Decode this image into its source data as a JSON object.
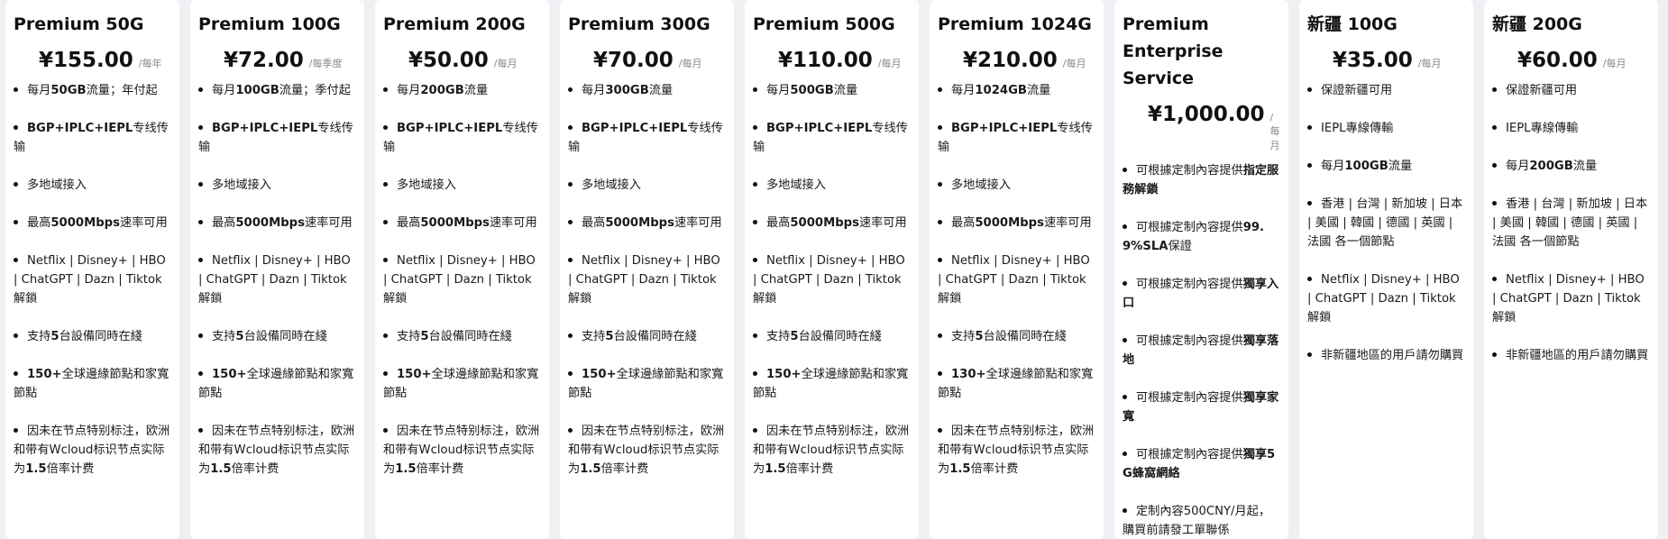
{
  "plans": [
    {
      "title": "Premium 50G",
      "price": "¥155.00",
      "period": "/每年",
      "features": [
        [
          {
            "t": "每月"
          },
          {
            "b": "50GB"
          },
          {
            "t": "流量；年付起"
          }
        ],
        [
          {
            "b": "BGP+IPLC+IEPL"
          },
          {
            "t": "专线传输"
          }
        ],
        [
          {
            "t": "多地域接入"
          }
        ],
        [
          {
            "t": "最高"
          },
          {
            "b": "5000Mbps"
          },
          {
            "t": "速率可用"
          }
        ],
        [
          {
            "t": "Netflix | Disney+ | HBO | ChatGPT | Dazn | Tiktok解鎖"
          }
        ],
        [
          {
            "t": "支持"
          },
          {
            "b": "5"
          },
          {
            "t": "台設備同時在綫"
          }
        ],
        [
          {
            "b": "150+"
          },
          {
            "t": "全球邊緣節點和家寬節點"
          }
        ],
        [
          {
            "t": "因未在节点特别标注，欧洲和带有Wcloud标识节点实际为"
          },
          {
            "b": "1.5"
          },
          {
            "t": "倍率计费"
          }
        ]
      ]
    },
    {
      "title": "Premium 100G",
      "price": "¥72.00",
      "period": "/每季度",
      "features": [
        [
          {
            "t": "每月"
          },
          {
            "b": "100GB"
          },
          {
            "t": "流量；季付起"
          }
        ],
        [
          {
            "b": "BGP+IPLC+IEPL"
          },
          {
            "t": "专线传输"
          }
        ],
        [
          {
            "t": "多地域接入"
          }
        ],
        [
          {
            "t": "最高"
          },
          {
            "b": "5000Mbps"
          },
          {
            "t": "速率可用"
          }
        ],
        [
          {
            "t": "Netflix | Disney+ | HBO | ChatGPT | Dazn | Tiktok解鎖"
          }
        ],
        [
          {
            "t": "支持"
          },
          {
            "b": "5"
          },
          {
            "t": "台設備同時在綫"
          }
        ],
        [
          {
            "b": "150+"
          },
          {
            "t": "全球邊緣節點和家寬節點"
          }
        ],
        [
          {
            "t": "因未在节点特别标注，欧洲和带有Wcloud标识节点实际为"
          },
          {
            "b": "1.5"
          },
          {
            "t": "倍率计费"
          }
        ]
      ]
    },
    {
      "title": "Premium 200G",
      "price": "¥50.00",
      "period": "/每月",
      "features": [
        [
          {
            "t": "每月"
          },
          {
            "b": "200GB"
          },
          {
            "t": "流量"
          }
        ],
        [
          {
            "b": "BGP+IPLC+IEPL"
          },
          {
            "t": "专线传输"
          }
        ],
        [
          {
            "t": "多地域接入"
          }
        ],
        [
          {
            "t": "最高"
          },
          {
            "b": "5000Mbps"
          },
          {
            "t": "速率可用"
          }
        ],
        [
          {
            "t": "Netflix | Disney+ | HBO | ChatGPT | Dazn | Tiktok解鎖"
          }
        ],
        [
          {
            "t": "支持"
          },
          {
            "b": "5"
          },
          {
            "t": "台設備同時在綫"
          }
        ],
        [
          {
            "b": "150+"
          },
          {
            "t": "全球邊緣節點和家寬節點"
          }
        ],
        [
          {
            "t": "因未在节点特别标注，欧洲和带有Wcloud标识节点实际为"
          },
          {
            "b": "1.5"
          },
          {
            "t": "倍率计费"
          }
        ]
      ]
    },
    {
      "title": "Premium 300G",
      "price": "¥70.00",
      "period": "/每月",
      "features": [
        [
          {
            "t": "每月"
          },
          {
            "b": "300GB"
          },
          {
            "t": "流量"
          }
        ],
        [
          {
            "b": "BGP+IPLC+IEPL"
          },
          {
            "t": "专线传输"
          }
        ],
        [
          {
            "t": "多地域接入"
          }
        ],
        [
          {
            "t": "最高"
          },
          {
            "b": "5000Mbps"
          },
          {
            "t": "速率可用"
          }
        ],
        [
          {
            "t": "Netflix | Disney+ | HBO | ChatGPT | Dazn | Tiktok解鎖"
          }
        ],
        [
          {
            "t": "支持"
          },
          {
            "b": "5"
          },
          {
            "t": "台設備同時在綫"
          }
        ],
        [
          {
            "b": "150+"
          },
          {
            "t": "全球邊緣節點和家寬節點"
          }
        ],
        [
          {
            "t": "因未在节点特别标注，欧洲和带有Wcloud标识节点实际为"
          },
          {
            "b": "1.5"
          },
          {
            "t": "倍率计费"
          }
        ]
      ]
    },
    {
      "title": "Premium 500G",
      "price": "¥110.00",
      "period": "/每月",
      "features": [
        [
          {
            "t": "每月"
          },
          {
            "b": "500GB"
          },
          {
            "t": "流量"
          }
        ],
        [
          {
            "b": "BGP+IPLC+IEPL"
          },
          {
            "t": "专线传输"
          }
        ],
        [
          {
            "t": "多地域接入"
          }
        ],
        [
          {
            "t": "最高"
          },
          {
            "b": "5000Mbps"
          },
          {
            "t": "速率可用"
          }
        ],
        [
          {
            "t": "Netflix | Disney+ | HBO | ChatGPT | Dazn | Tiktok解鎖"
          }
        ],
        [
          {
            "t": "支持"
          },
          {
            "b": "5"
          },
          {
            "t": "台設備同時在綫"
          }
        ],
        [
          {
            "b": "150+"
          },
          {
            "t": "全球邊緣節點和家寬節點"
          }
        ],
        [
          {
            "t": "因未在节点特别标注，欧洲和带有Wcloud标识节点实际为"
          },
          {
            "b": "1.5"
          },
          {
            "t": "倍率计费"
          }
        ]
      ]
    },
    {
      "title": "Premium 1024G",
      "price": "¥210.00",
      "period": "/每月",
      "features": [
        [
          {
            "t": "每月"
          },
          {
            "b": "1024GB"
          },
          {
            "t": "流量"
          }
        ],
        [
          {
            "b": "BGP+IPLC+IEPL"
          },
          {
            "t": "专线传输"
          }
        ],
        [
          {
            "t": "多地域接入"
          }
        ],
        [
          {
            "t": "最高"
          },
          {
            "b": "5000Mbps"
          },
          {
            "t": "速率可用"
          }
        ],
        [
          {
            "t": "Netflix | Disney+ | HBO | ChatGPT | Dazn | Tiktok解鎖"
          }
        ],
        [
          {
            "t": "支持"
          },
          {
            "b": "5"
          },
          {
            "t": "台設備同時在綫"
          }
        ],
        [
          {
            "b": "130+"
          },
          {
            "t": "全球邊緣節點和家寬節點"
          }
        ],
        [
          {
            "t": "因未在节点特别标注，欧洲和带有Wcloud标识节点实际为"
          },
          {
            "b": "1.5"
          },
          {
            "t": "倍率计费"
          }
        ]
      ]
    },
    {
      "title": "Premium Enterprise Service",
      "price": "¥1,000.00",
      "period": "/每月",
      "features": [
        [
          {
            "t": "可根據定制內容提供"
          },
          {
            "b": "指定服務解鎖"
          }
        ],
        [
          {
            "t": "可根據定制內容提供"
          },
          {
            "b": "99.9%SLA"
          },
          {
            "t": "保證"
          }
        ],
        [
          {
            "t": "可根據定制內容提供"
          },
          {
            "b": "獨享入口"
          }
        ],
        [
          {
            "t": "可根據定制內容提供"
          },
          {
            "b": "獨享落地"
          }
        ],
        [
          {
            "t": "可根據定制內容提供"
          },
          {
            "b": "獨享家寬"
          }
        ],
        [
          {
            "t": "可根據定制內容提供"
          },
          {
            "b": "獨享5G蜂窩網絡"
          }
        ],
        [
          {
            "t": "定制內容500CNY/月起，購買前請發工單聯係"
          }
        ]
      ]
    },
    {
      "title": "新疆 100G",
      "price": "¥35.00",
      "period": "/每月",
      "features": [
        [
          {
            "t": "保證新疆可用"
          }
        ],
        [
          {
            "t": "IEPL專線傳輸"
          }
        ],
        [
          {
            "t": "每月"
          },
          {
            "b": "100GB"
          },
          {
            "t": "流量"
          }
        ],
        [
          {
            "t": "香港 | 台灣 | 新加坡 | 日本 | 美國 | 韓國 | 德國 | 英國 | 法國 各一個節點"
          }
        ],
        [
          {
            "t": "Netflix | Disney+ | HBO | ChatGPT | Dazn | Tiktok解鎖"
          }
        ],
        [
          {
            "t": "非新疆地區的用戶請勿購買"
          }
        ]
      ]
    },
    {
      "title": "新疆 200G",
      "price": "¥60.00",
      "period": "/每月",
      "features": [
        [
          {
            "t": "保證新疆可用"
          }
        ],
        [
          {
            "t": "IEPL專線傳輸"
          }
        ],
        [
          {
            "t": "每月"
          },
          {
            "b": "200GB"
          },
          {
            "t": "流量"
          }
        ],
        [
          {
            "t": "香港 | 台灣 | 新加坡 | 日本 | 美國 | 韓國 | 德國 | 英國 | 法國 各一個節點"
          }
        ],
        [
          {
            "t": "Netflix | Disney+ | HBO | ChatGPT | Dazn | Tiktok解鎖"
          }
        ],
        [
          {
            "t": "非新疆地區的用戶請勿購買"
          }
        ]
      ]
    }
  ]
}
